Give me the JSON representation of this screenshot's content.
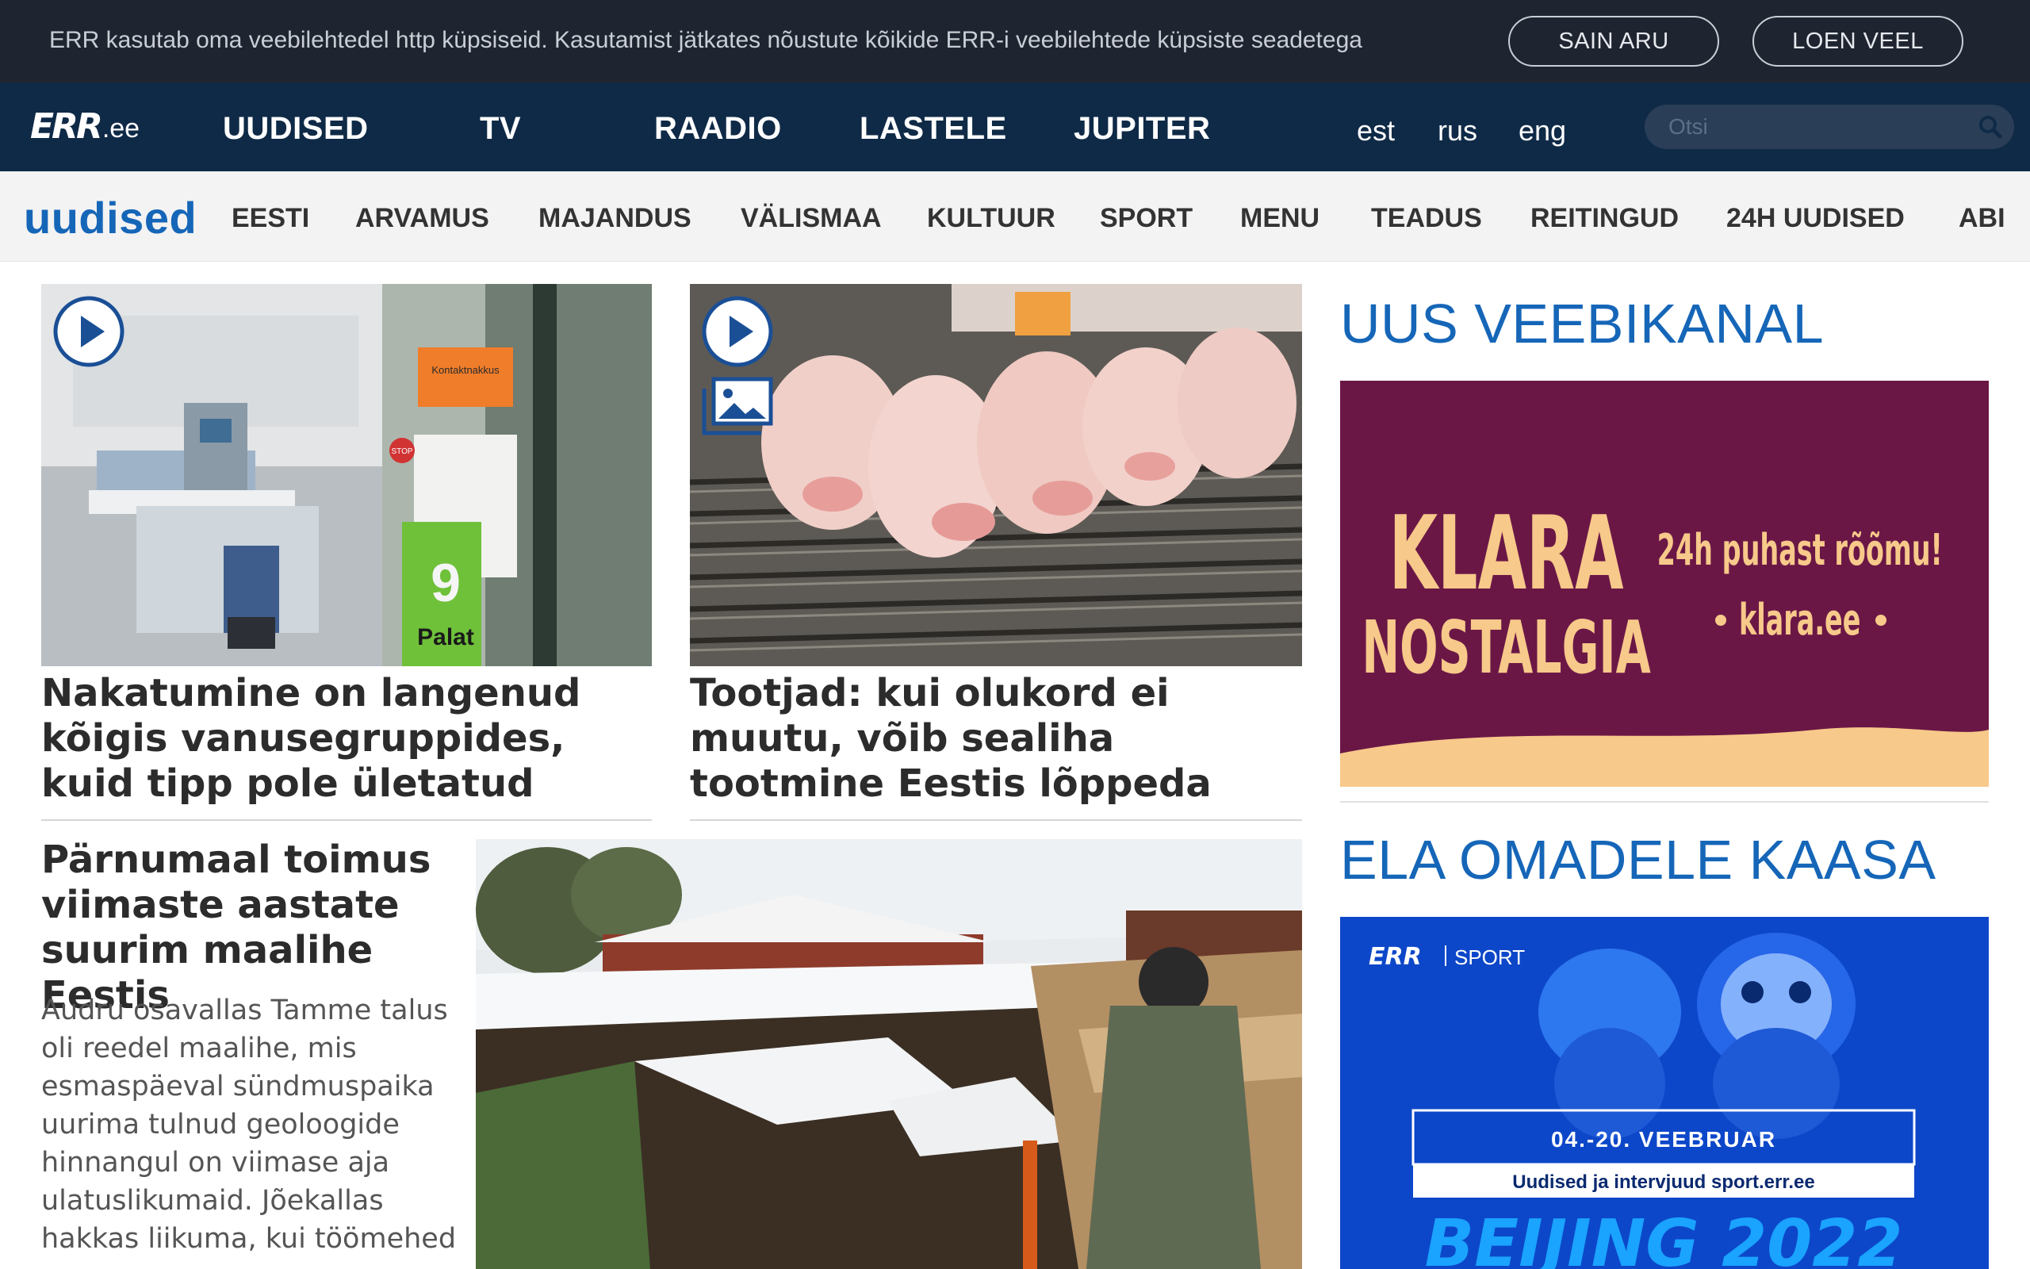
{
  "cookie": {
    "text": "ERR kasutab oma veebilehtedel http küpsiseid. Kasutamist jätkates nõustute kõikide ERR-i veebilehtede küpsiste seadetega",
    "accept_label": "SAIN ARU",
    "more_label": "LOEN VEEL"
  },
  "header": {
    "logo_mark": "ERR",
    "logo_tld": ".ee",
    "nav": [
      "UUDISED",
      "TV",
      "RAADIO",
      "LASTELE",
      "JUPITER"
    ],
    "langs": [
      "est",
      "rus",
      "eng"
    ],
    "search_placeholder": "Otsi"
  },
  "subnav": {
    "section": "uudised",
    "items": [
      "EESTI",
      "ARVAMUS",
      "MAJANDUS",
      "VÄLISMAA",
      "KULTUUR",
      "SPORT",
      "MENU",
      "TEADUS",
      "REITINGUD",
      "24H UUDISED",
      "ABI"
    ]
  },
  "articles": [
    {
      "headline": "Nakatumine on langenud kõigis vanusegruppides, kuid tipp pole ületatud",
      "icons": [
        "play-icon"
      ],
      "image_labels": {
        "door_sign": "Kontaktnakkus",
        "stop": "STOP",
        "room_number": "9",
        "room_word": "Palat"
      }
    },
    {
      "headline": "Tootjad: kui olukord ei muutu, võib sealiha tootmine Eestis lõppeda",
      "icons": [
        "play-icon",
        "gallery-icon"
      ]
    },
    {
      "headline": "Pärnumaal toimus viimaste aastate suurim maalihe Eestis",
      "lead": "Audru osavallas Tamme talus oli reedel maalihe, mis esmaspäeval sündmuspaika uurima tulnud geoloogide hinnangul on viimase aja ulatuslikumaid. Jõekallas hakkas liikuma, kui töömehed",
      "icons": []
    }
  ],
  "sidebar": {
    "heading1": "UUS VEEBIKANAL",
    "banner1": {
      "title_line1": "KLARA",
      "title_line2": "NOSTALGIA",
      "tagline": "24h puhast rõõmu!",
      "url": "klara.ee",
      "bg": "#6b1746",
      "accent": "#f7c98a"
    },
    "heading2": "ELA OMADELE KAASA",
    "banner2": {
      "brand": "ERR",
      "channel": "SPORT",
      "dates": "04.-20. VEEBRUAR",
      "subline": "Uudised ja intervjuud sport.err.ee",
      "bottom_text": "BEIJING 2022",
      "bg": "#0d47c9"
    }
  },
  "colors": {
    "cookie_bg": "#1f2530",
    "nav_bg": "#0f2a47",
    "accent_blue": "#1666b8",
    "subnav_bg": "#f3f3f3"
  }
}
